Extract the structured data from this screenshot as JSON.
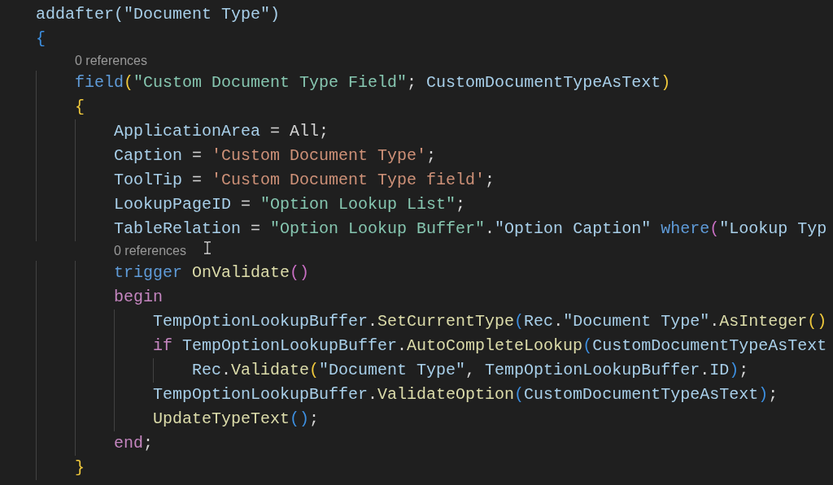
{
  "editor": {
    "lines": [
      {
        "kind": "code",
        "tokens": [
          {
            "text": "addafter(\"Document Type\")",
            "kind": "variable"
          }
        ]
      },
      {
        "kind": "code",
        "tokens": [
          {
            "text": "{",
            "kind": "bracket3"
          }
        ],
        "children": [
          {
            "kind": "codelens",
            "text": "0 references"
          },
          {
            "kind": "code",
            "tokens": [
              {
                "text": "field",
                "kind": "keyword"
              },
              {
                "text": "(",
                "kind": "bracket1"
              },
              {
                "text": "\"Custom Document Type Field\"",
                "kind": "table"
              },
              {
                "text": "; ",
                "kind": "operator"
              },
              {
                "text": "CustomDocumentTypeAsText",
                "kind": "variable"
              },
              {
                "text": ")",
                "kind": "bracket1"
              }
            ]
          },
          {
            "kind": "code",
            "tokens": [
              {
                "text": "{",
                "kind": "bracket1"
              }
            ],
            "children": [
              {
                "kind": "code",
                "tokens": [
                  {
                    "text": "ApplicationArea",
                    "kind": "variable"
                  },
                  {
                    "text": " = ",
                    "kind": "operator"
                  },
                  {
                    "text": "All",
                    "kind": "operator"
                  },
                  {
                    "text": ";",
                    "kind": "operator"
                  }
                ]
              },
              {
                "kind": "code",
                "tokens": [
                  {
                    "text": "Caption",
                    "kind": "variable"
                  },
                  {
                    "text": " = ",
                    "kind": "operator"
                  },
                  {
                    "text": "'Custom Document Type'",
                    "kind": "string"
                  },
                  {
                    "text": ";",
                    "kind": "operator"
                  }
                ]
              },
              {
                "kind": "code",
                "tokens": [
                  {
                    "text": "ToolTip",
                    "kind": "variable"
                  },
                  {
                    "text": " = ",
                    "kind": "operator"
                  },
                  {
                    "text": "'Custom Document Type field'",
                    "kind": "string"
                  },
                  {
                    "text": ";",
                    "kind": "operator"
                  }
                ]
              },
              {
                "kind": "code",
                "tokens": [
                  {
                    "text": "LookupPageID",
                    "kind": "variable"
                  },
                  {
                    "text": " = ",
                    "kind": "operator"
                  },
                  {
                    "text": "\"Option Lookup List\"",
                    "kind": "table"
                  },
                  {
                    "text": ";",
                    "kind": "operator"
                  }
                ]
              },
              {
                "kind": "code",
                "tokens": [
                  {
                    "text": "TableRelation",
                    "kind": "variable"
                  },
                  {
                    "text": " = ",
                    "kind": "operator"
                  },
                  {
                    "text": "\"Option Lookup Buffer\"",
                    "kind": "table"
                  },
                  {
                    "text": ".",
                    "kind": "operator"
                  },
                  {
                    "text": "\"Option Caption\" ",
                    "kind": "variable"
                  },
                  {
                    "text": "where",
                    "kind": "keyword"
                  },
                  {
                    "text": "(",
                    "kind": "bracket2"
                  },
                  {
                    "text": "\"Lookup Typ",
                    "kind": "variable"
                  }
                ]
              },
              {
                "kind": "codelens",
                "text": "0 references"
              },
              {
                "kind": "code",
                "tokens": [
                  {
                    "text": "trigger ",
                    "kind": "keyword"
                  },
                  {
                    "text": "OnValidate",
                    "kind": "function"
                  },
                  {
                    "text": "()",
                    "kind": "bracket2"
                  }
                ]
              },
              {
                "kind": "code",
                "tokens": [
                  {
                    "text": "begin",
                    "kind": "control"
                  }
                ],
                "children": [
                  {
                    "kind": "code",
                    "tokens": [
                      {
                        "text": "TempOptionLookupBuffer",
                        "kind": "variable"
                      },
                      {
                        "text": ".",
                        "kind": "operator"
                      },
                      {
                        "text": "SetCurrentType",
                        "kind": "function"
                      },
                      {
                        "text": "(",
                        "kind": "bracket3"
                      },
                      {
                        "text": "Rec",
                        "kind": "variable"
                      },
                      {
                        "text": ".",
                        "kind": "operator"
                      },
                      {
                        "text": "\"Document Type\"",
                        "kind": "variable"
                      },
                      {
                        "text": ".",
                        "kind": "operator"
                      },
                      {
                        "text": "AsInteger",
                        "kind": "function"
                      },
                      {
                        "text": "()",
                        "kind": "bracket1"
                      }
                    ]
                  },
                  {
                    "kind": "code",
                    "tokens": [
                      {
                        "text": "if ",
                        "kind": "control"
                      },
                      {
                        "text": "TempOptionLookupBuffer",
                        "kind": "variable"
                      },
                      {
                        "text": ".",
                        "kind": "operator"
                      },
                      {
                        "text": "AutoCompleteLookup",
                        "kind": "function"
                      },
                      {
                        "text": "(",
                        "kind": "bracket3"
                      },
                      {
                        "text": "CustomDocumentTypeAsText",
                        "kind": "variable"
                      }
                    ],
                    "children": [
                      {
                        "kind": "code",
                        "tokens": [
                          {
                            "text": "Rec",
                            "kind": "variable"
                          },
                          {
                            "text": ".",
                            "kind": "operator"
                          },
                          {
                            "text": "Validate",
                            "kind": "function"
                          },
                          {
                            "text": "(",
                            "kind": "bracket1"
                          },
                          {
                            "text": "\"Document Type\"",
                            "kind": "variable"
                          },
                          {
                            "text": ", ",
                            "kind": "operator"
                          },
                          {
                            "text": "TempOptionLookupBuffer",
                            "kind": "variable"
                          },
                          {
                            "text": ".",
                            "kind": "operator"
                          },
                          {
                            "text": "ID",
                            "kind": "variable"
                          },
                          {
                            "text": ")",
                            "kind": "bracket3"
                          },
                          {
                            "text": ";",
                            "kind": "operator"
                          }
                        ]
                      }
                    ]
                  },
                  {
                    "kind": "code",
                    "tokens": [
                      {
                        "text": "TempOptionLookupBuffer",
                        "kind": "variable"
                      },
                      {
                        "text": ".",
                        "kind": "operator"
                      },
                      {
                        "text": "ValidateOption",
                        "kind": "function"
                      },
                      {
                        "text": "(",
                        "kind": "bracket3"
                      },
                      {
                        "text": "CustomDocumentTypeAsText",
                        "kind": "variable"
                      },
                      {
                        "text": ")",
                        "kind": "bracket3"
                      },
                      {
                        "text": ";",
                        "kind": "operator"
                      }
                    ]
                  },
                  {
                    "kind": "code",
                    "tokens": [
                      {
                        "text": "UpdateTypeText",
                        "kind": "function"
                      },
                      {
                        "text": "()",
                        "kind": "bracket3"
                      },
                      {
                        "text": ";",
                        "kind": "operator"
                      }
                    ]
                  }
                ]
              },
              {
                "kind": "code",
                "tokens": [
                  {
                    "text": "end",
                    "kind": "control"
                  },
                  {
                    "text": ";",
                    "kind": "operator"
                  }
                ]
              }
            ]
          },
          {
            "kind": "code",
            "tokens": [
              {
                "text": "}",
                "kind": "bracket1"
              }
            ]
          }
        ]
      }
    ]
  }
}
